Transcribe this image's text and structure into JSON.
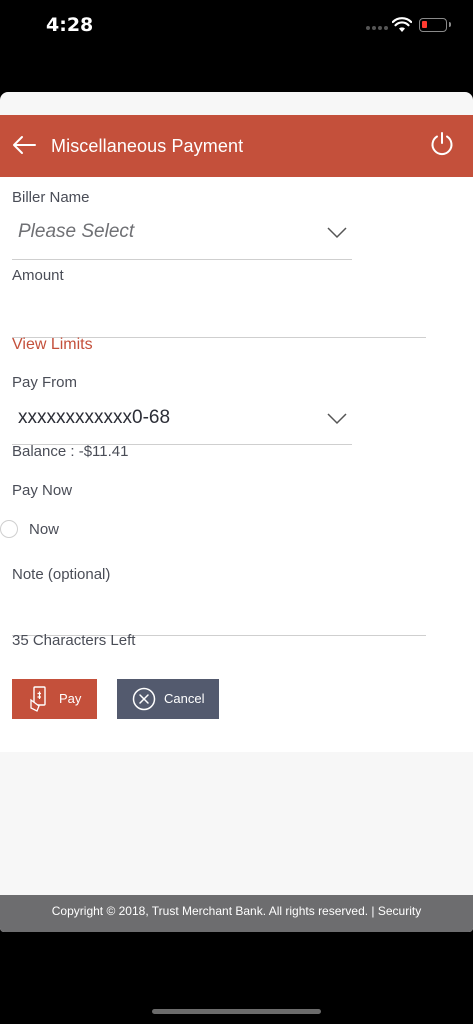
{
  "status_bar": {
    "time": "4:28"
  },
  "header": {
    "title": "Miscellaneous Payment"
  },
  "form": {
    "biller_label": "Biller Name",
    "biller_placeholder": "Please Select",
    "amount_label": "Amount",
    "view_limits": "View Limits",
    "pay_from_label": "Pay From",
    "pay_from_value": "xxxxxxxxxxxx0-68",
    "balance": "Balance : -$11.41",
    "pay_now_label": "Pay Now",
    "now_option": "Now",
    "note_label": "Note (optional)",
    "chars_left": "35 Characters Left"
  },
  "buttons": {
    "pay": "Pay",
    "cancel": "Cancel"
  },
  "footer": {
    "text": "Copyright © 2018, Trust Merchant Bank. All rights reserved. | Security"
  },
  "colors": {
    "brand": "#c4503b",
    "secondary_button": "#535a6e",
    "footer": "#6d6d6f"
  },
  "icons": [
    "back-arrow-icon",
    "power-icon",
    "chevron-down-icon",
    "pay-icon",
    "cancel-icon",
    "wifi-icon",
    "battery-icon"
  ]
}
